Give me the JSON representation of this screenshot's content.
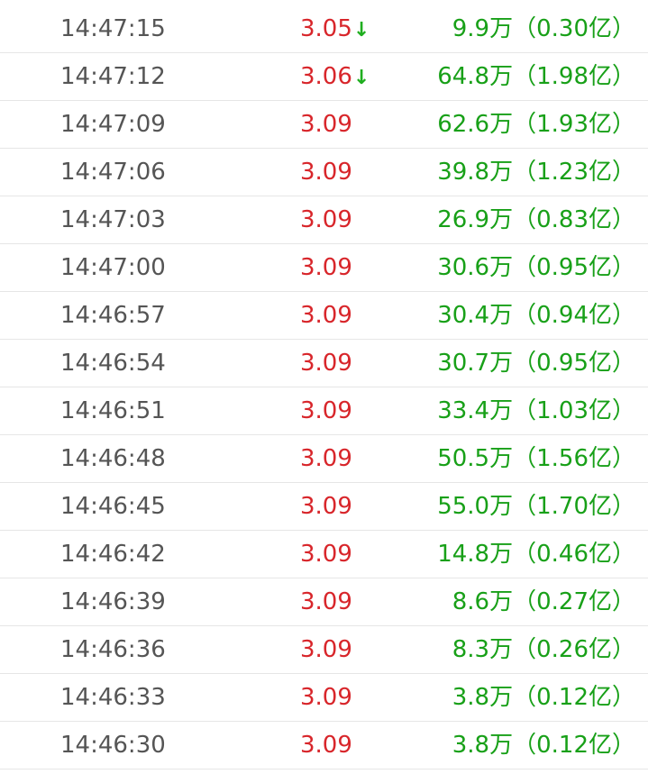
{
  "colors": {
    "time_text": "#555555",
    "price_text": "#d8262b",
    "volume_text": "#18a018",
    "arrow_down": "#1fae1f",
    "divider": "#e6e6e6"
  },
  "trades": [
    {
      "time": "14:47:15",
      "price": "3.05",
      "arrow": "↓",
      "volume": "9.9万（0.30亿）"
    },
    {
      "time": "14:47:12",
      "price": "3.06",
      "arrow": "↓",
      "volume": "64.8万（1.98亿）"
    },
    {
      "time": "14:47:09",
      "price": "3.09",
      "arrow": "",
      "volume": "62.6万（1.93亿）"
    },
    {
      "time": "14:47:06",
      "price": "3.09",
      "arrow": "",
      "volume": "39.8万（1.23亿）"
    },
    {
      "time": "14:47:03",
      "price": "3.09",
      "arrow": "",
      "volume": "26.9万（0.83亿）"
    },
    {
      "time": "14:47:00",
      "price": "3.09",
      "arrow": "",
      "volume": "30.6万（0.95亿）"
    },
    {
      "time": "14:46:57",
      "price": "3.09",
      "arrow": "",
      "volume": "30.4万（0.94亿）"
    },
    {
      "time": "14:46:54",
      "price": "3.09",
      "arrow": "",
      "volume": "30.7万（0.95亿）"
    },
    {
      "time": "14:46:51",
      "price": "3.09",
      "arrow": "",
      "volume": "33.4万（1.03亿）"
    },
    {
      "time": "14:46:48",
      "price": "3.09",
      "arrow": "",
      "volume": "50.5万（1.56亿）"
    },
    {
      "time": "14:46:45",
      "price": "3.09",
      "arrow": "",
      "volume": "55.0万（1.70亿）"
    },
    {
      "time": "14:46:42",
      "price": "3.09",
      "arrow": "",
      "volume": "14.8万（0.46亿）"
    },
    {
      "time": "14:46:39",
      "price": "3.09",
      "arrow": "",
      "volume": "8.6万（0.27亿）"
    },
    {
      "time": "14:46:36",
      "price": "3.09",
      "arrow": "",
      "volume": "8.3万（0.26亿）"
    },
    {
      "time": "14:46:33",
      "price": "3.09",
      "arrow": "",
      "volume": "3.8万（0.12亿）"
    },
    {
      "time": "14:46:30",
      "price": "3.09",
      "arrow": "",
      "volume": "3.8万（0.12亿）"
    }
  ]
}
